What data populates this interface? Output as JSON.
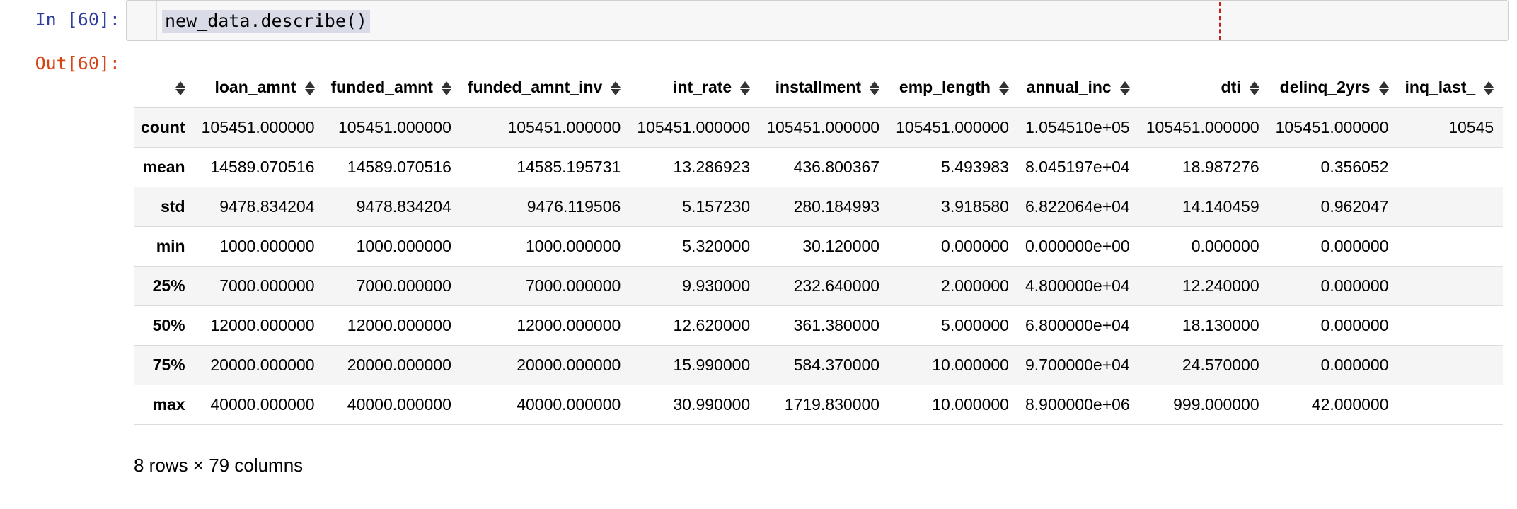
{
  "input_cell": {
    "prompt": "In [60]:",
    "code": "new_data.describe()"
  },
  "output_cell": {
    "prompt": "Out[60]:",
    "shape_text": "8 rows × 79 columns"
  },
  "table": {
    "columns": [
      "loan_amnt",
      "funded_amnt",
      "funded_amnt_inv",
      "int_rate",
      "installment",
      "emp_length",
      "annual_inc",
      "dti",
      "delinq_2yrs",
      "inq_last_"
    ],
    "rows": [
      {
        "label": "count",
        "values": [
          "105451.000000",
          "105451.000000",
          "105451.000000",
          "105451.000000",
          "105451.000000",
          "105451.000000",
          "1.054510e+05",
          "105451.000000",
          "105451.000000",
          "10545"
        ]
      },
      {
        "label": "mean",
        "values": [
          "14589.070516",
          "14589.070516",
          "14585.195731",
          "13.286923",
          "436.800367",
          "5.493983",
          "8.045197e+04",
          "18.987276",
          "0.356052",
          ""
        ]
      },
      {
        "label": "std",
        "values": [
          "9478.834204",
          "9478.834204",
          "9476.119506",
          "5.157230",
          "280.184993",
          "3.918580",
          "6.822064e+04",
          "14.140459",
          "0.962047",
          ""
        ]
      },
      {
        "label": "min",
        "values": [
          "1000.000000",
          "1000.000000",
          "1000.000000",
          "5.320000",
          "30.120000",
          "0.000000",
          "0.000000e+00",
          "0.000000",
          "0.000000",
          ""
        ]
      },
      {
        "label": "25%",
        "values": [
          "7000.000000",
          "7000.000000",
          "7000.000000",
          "9.930000",
          "232.640000",
          "2.000000",
          "4.800000e+04",
          "12.240000",
          "0.000000",
          ""
        ]
      },
      {
        "label": "50%",
        "values": [
          "12000.000000",
          "12000.000000",
          "12000.000000",
          "12.620000",
          "361.380000",
          "5.000000",
          "6.800000e+04",
          "18.130000",
          "0.000000",
          ""
        ]
      },
      {
        "label": "75%",
        "values": [
          "20000.000000",
          "20000.000000",
          "20000.000000",
          "15.990000",
          "584.370000",
          "10.000000",
          "9.700000e+04",
          "24.570000",
          "0.000000",
          ""
        ]
      },
      {
        "label": "max",
        "values": [
          "40000.000000",
          "40000.000000",
          "40000.000000",
          "30.990000",
          "1719.830000",
          "10.000000",
          "8.900000e+06",
          "999.000000",
          "42.000000",
          ""
        ]
      }
    ]
  },
  "colors": {
    "in_prompt": "#303f9f",
    "out_prompt": "#d84315",
    "code_selection": "#d9dbe6",
    "ruler": "#c81e1e"
  }
}
